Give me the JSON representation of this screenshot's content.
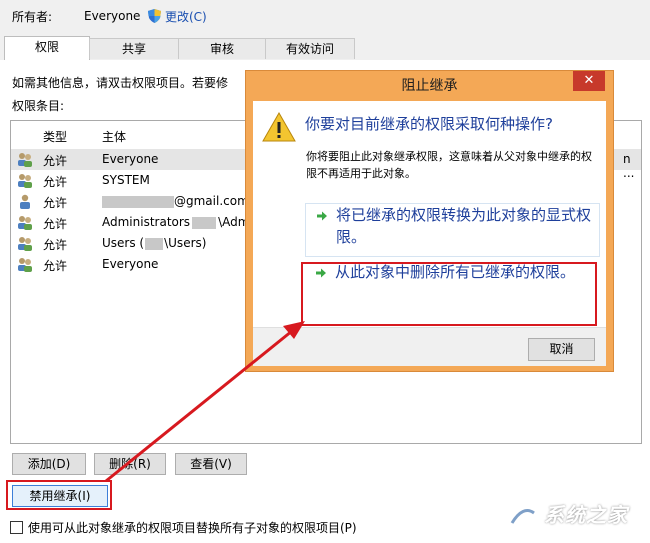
{
  "owner": {
    "label": "所有者:",
    "value": "Everyone",
    "change_link": "更改(C)"
  },
  "tabs": [
    {
      "label": "权限",
      "active": true
    },
    {
      "label": "共享",
      "active": false
    },
    {
      "label": "审核",
      "active": false
    },
    {
      "label": "有效访问",
      "active": false
    }
  ],
  "info_text": "如需其他信息，请双击权限项目。若要修",
  "entries_label": "权限条目:",
  "list": {
    "headers": [
      "类型",
      "主体"
    ],
    "rows": [
      {
        "type": "允许",
        "principal": "Everyone",
        "icon": "users-icon",
        "selected": true,
        "tail": "n ..."
      },
      {
        "type": "允许",
        "principal": "SYSTEM",
        "icon": "users-icon"
      },
      {
        "type": "允许",
        "principal_suffix": "@gmail.com",
        "icon": "user-icon"
      },
      {
        "type": "允许",
        "principal": "Administrators",
        "principal_mid": "\\Admi",
        "icon": "users-icon"
      },
      {
        "type": "允许",
        "principal": "Users (",
        "principal_mid": "\\Users)",
        "icon": "users-icon"
      },
      {
        "type": "允许",
        "principal": "Everyone",
        "icon": "users-icon"
      }
    ]
  },
  "buttons": {
    "add": "添加(D)",
    "remove": "删除(R)",
    "view": "查看(V)",
    "disable_inheritance": "禁用继承(I)"
  },
  "replace_checkbox_label": "使用可从此对象继承的权限项目替换所有子对象的权限项目(P)",
  "watermark": {
    "text": "系统之家"
  },
  "dialog": {
    "title": "阻止继承",
    "question": "你要对目前继承的权限采取何种操作?",
    "description": "你将要阻止此对象继承权限，这意味着从父对象中继承的权限不再适用于此对象。",
    "option1": "将已继承的权限转换为此对象的显式权限。",
    "option2": "从此对象中删除所有已继承的权限。",
    "cancel": "取消",
    "close": "✕"
  },
  "colors": {
    "accent_blue": "#1e3f9b",
    "highlight_red": "#d7191f",
    "dialog_frame": "#f4a856"
  }
}
